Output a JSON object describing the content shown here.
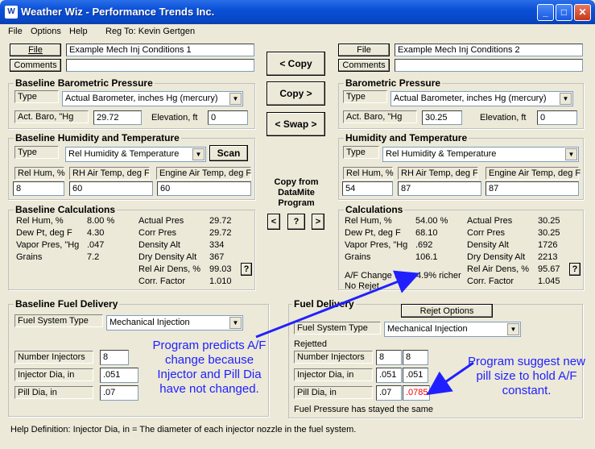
{
  "window": {
    "title": "Weather Wiz - Performance Trends Inc.",
    "minimize": "_",
    "maximize": "□",
    "close": "✕"
  },
  "menu": {
    "file": "File",
    "options": "Options",
    "help": "Help",
    "reg": "Reg To: Kevin Gertgen"
  },
  "left": {
    "file_btn": "File",
    "comments_btn": "Comments",
    "condition_name": "Example Mech Inj Conditions 1",
    "comments": "",
    "baro_title": "Baseline Barometric Pressure",
    "type_label": "Type",
    "baro_type": "Actual Barometer, inches Hg (mercury)",
    "act_baro_label": "Act. Baro, \"Hg",
    "act_baro": "29.72",
    "elev_label": "Elevation, ft",
    "elev": "0",
    "hum_title": "Baseline Humidity and Temperature",
    "hum_type": "Rel Humidity & Temperature",
    "scan_btn": "Scan",
    "rel_hum_label": "Rel Hum, %",
    "rel_hum": "8",
    "rh_air_label": "RH Air Temp, deg F",
    "rh_air": "60",
    "eng_air_label": "Engine Air Temp, deg F",
    "eng_air": "60",
    "calc_title": "Baseline Calculations",
    "calc_left": [
      [
        "Rel Hum, %",
        "8.00 %"
      ],
      [
        "Dew Pt, deg F",
        "4.30"
      ],
      [
        "Vapor Pres, \"Hg",
        ".047"
      ],
      [
        "Grains",
        "7.2"
      ]
    ],
    "calc_right": [
      [
        "Actual Pres",
        "29.72"
      ],
      [
        "Corr Pres",
        "29.72"
      ],
      [
        "Density Alt",
        "334"
      ],
      [
        "Dry Density Alt",
        "367"
      ],
      [
        "Rel Air Dens, %",
        "99.03"
      ],
      [
        "Corr. Factor",
        "1.010"
      ]
    ],
    "help_q": "?",
    "fuel_title": "Baseline Fuel Delivery",
    "fuel_sys_label": "Fuel System Type",
    "fuel_sys": "Mechanical Injection",
    "num_inj_label": "Number Injectors",
    "num_inj": "8",
    "inj_dia_label": "Injector Dia, in",
    "inj_dia": ".051",
    "pill_dia_label": "Pill Dia, in",
    "pill_dia": ".07"
  },
  "middle": {
    "copy_left": "< Copy",
    "copy_right": "Copy >",
    "swap": "< Swap >",
    "datamite_label": "Copy from DataMite Program",
    "dm_left": "<",
    "dm_q": "?",
    "dm_right": ">"
  },
  "right": {
    "file_btn": "File",
    "comments_btn": "Comments",
    "condition_name": "Example Mech Inj Conditions 2",
    "comments": "",
    "baro_title": "Barometric Pressure",
    "type_label": "Type",
    "baro_type": "Actual Barometer, inches Hg (mercury)",
    "act_baro_label": "Act. Baro, \"Hg",
    "act_baro": "30.25",
    "elev_label": "Elevation, ft",
    "elev": "0",
    "hum_title": "Humidity and Temperature",
    "hum_type": "Rel Humidity & Temperature",
    "rel_hum_label": "Rel Hum, %",
    "rel_hum": "54",
    "rh_air_label": "RH Air Temp, deg F",
    "rh_air": "87",
    "eng_air_label": "Engine Air Temp, deg F",
    "eng_air": "87",
    "calc_title": "Calculations",
    "calc_left": [
      [
        "Rel Hum, %",
        "54.00 %"
      ],
      [
        "Dew Pt, deg F",
        "68.10"
      ],
      [
        "Vapor Pres, \"Hg",
        ".692"
      ],
      [
        "Grains",
        "106.1"
      ]
    ],
    "calc_right": [
      [
        "Actual Pres",
        "30.25"
      ],
      [
        "Corr Pres",
        "30.25"
      ],
      [
        "Density Alt",
        "1726"
      ],
      [
        "Dry Density Alt",
        "2213"
      ],
      [
        "Rel Air Dens, %",
        "95.67"
      ],
      [
        "Corr. Factor",
        "1.045"
      ]
    ],
    "af_change_label": "A/F Change w",
    "af_change_value": "4.9% richer",
    "no_rejet": "No Rejet",
    "help_q": "?",
    "fuel_title": "Fuel Delivery",
    "rejet_btn": "Rejet Options",
    "fuel_sys_label": "Fuel System Type",
    "fuel_sys": "Mechanical Injection",
    "rejetted": "Rejetted",
    "num_inj_label": "Number Injectors",
    "num_inj": "8",
    "num_inj_rejet": "8",
    "inj_dia_label": "Injector Dia, in",
    "inj_dia": ".051",
    "inj_dia_rejet": ".051",
    "pill_dia_label": "Pill Dia, in",
    "pill_dia": ".07",
    "pill_dia_rejet": ".0785",
    "fuel_note": "Fuel Pressure has stayed the same"
  },
  "annotations": {
    "left": "Program predicts A/F change because Injector and Pill Dia have not changed.",
    "right": "Program suggest new pill size to hold A/F constant.",
    "color": "#2020ff"
  },
  "help_def": "Help Definition:  Injector Dia, in = The diameter of each injector nozzle in the fuel system."
}
